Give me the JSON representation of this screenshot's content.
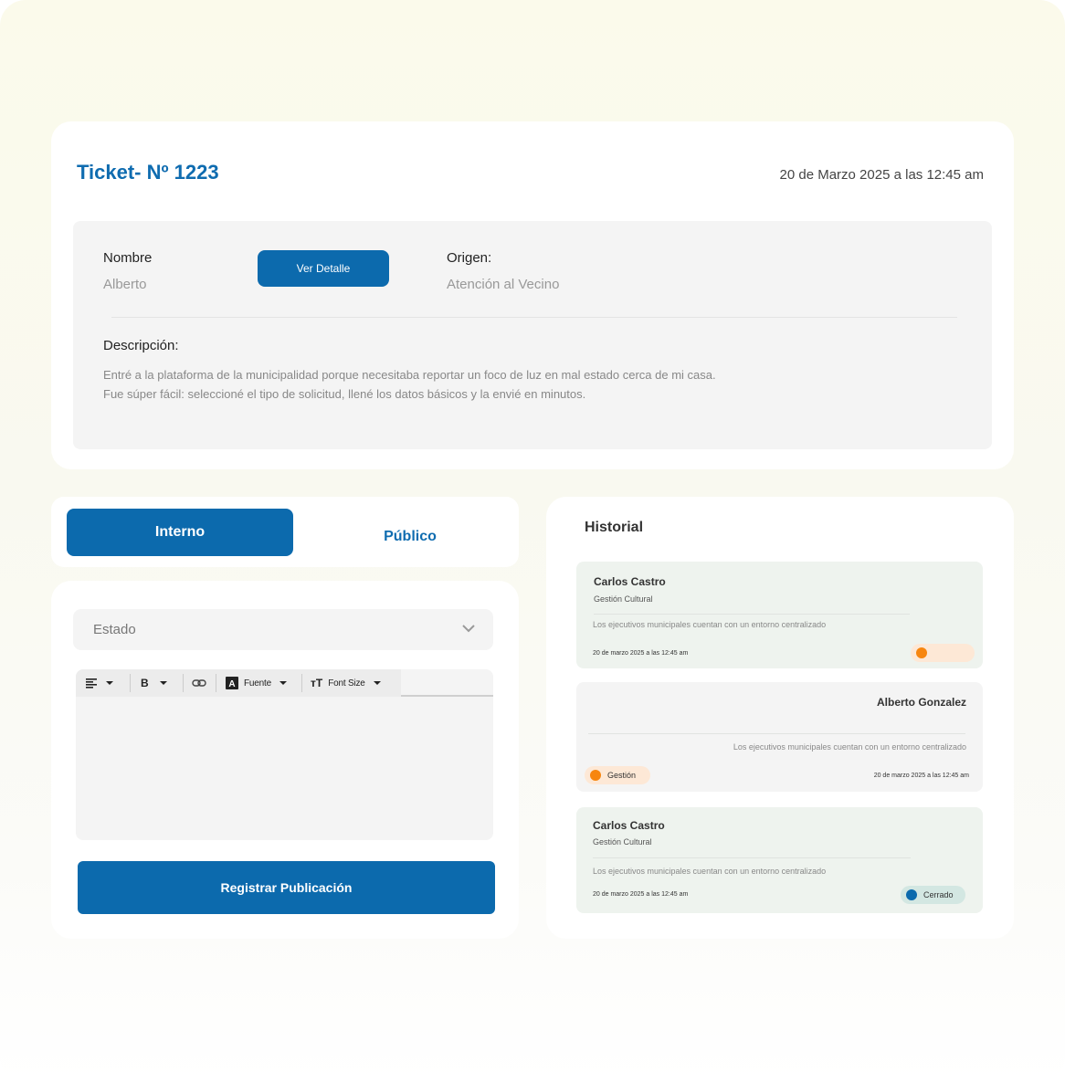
{
  "ticket": {
    "title": "Ticket- Nº 1223",
    "date": "20 de Marzo 2025 a las 12:45 am",
    "nombre_label": "Nombre",
    "nombre_value": "Alberto",
    "detail_button": "Ver Detalle",
    "origen_label": "Origen:",
    "origen_value": "Atención al Vecino",
    "descripcion_label": "Descripción:",
    "descripcion_text": "Entré a la plataforma de la municipalidad porque necesitaba reportar un foco de luz en mal estado cerca de mi casa. Fue súper fácil: seleccioné el tipo de solicitud, llené los datos básicos y la envié en minutos."
  },
  "tabs": {
    "interno": "Interno",
    "publico": "Público"
  },
  "form": {
    "estado_placeholder": "Estado",
    "toolbar": {
      "align_icon": "align-left-icon",
      "bold_icon": "bold-icon",
      "link_icon": "link-icon",
      "fuente": "Fuente",
      "font_size": "Font Size"
    },
    "register_button": "Registrar Publicación"
  },
  "historial": {
    "title": "Historial",
    "entries": [
      {
        "name": "Carlos Castro",
        "area": "Gestión Cultural",
        "text": "Los ejecutivos municipales cuentan con un entorno centralizado",
        "date": "20 de marzo 2025 a las 12:45 am",
        "badge": "",
        "badge_color": "#f7860f",
        "badge_bg": "#fde8d6"
      },
      {
        "name": "Alberto Gonzalez",
        "text": "Los ejecutivos municipales cuentan con un entorno centralizado",
        "date": "20 de marzo 2025 a las 12:45 am",
        "badge": "Gestión",
        "badge_color": "#f7860f",
        "badge_bg": "#fde8d6"
      },
      {
        "name": "Carlos Castro",
        "area": "Gestión Cultural",
        "text": "Los ejecutivos municipales cuentan con un entorno centralizado",
        "date": "20 de marzo 2025 a las 12:45 am",
        "badge": "Cerrado",
        "badge_color": "#0c6aad",
        "badge_bg": "#d3e7e2"
      }
    ]
  },
  "colors": {
    "primary": "#0c6aad",
    "title_blue": "#0f6cb0"
  }
}
